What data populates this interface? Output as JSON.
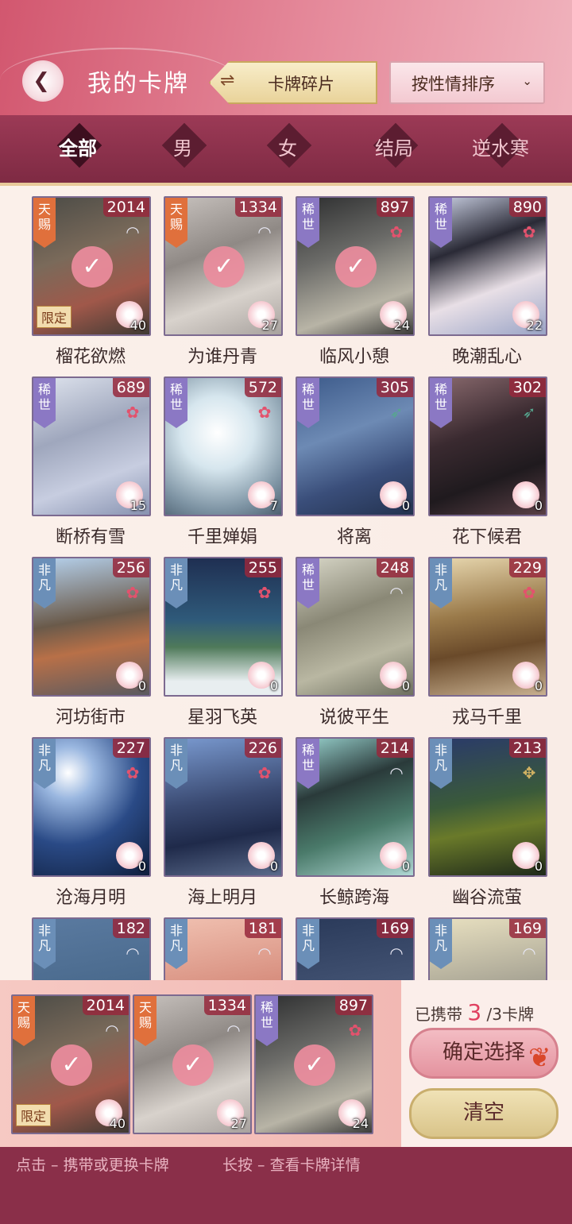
{
  "header": {
    "title": "我的卡牌",
    "fragments_label": "卡牌碎片",
    "sort_label": "按性情排序",
    "swap_icon": "⇌",
    "chevron": "⌄",
    "back_icon": "❮"
  },
  "filters": [
    "全部",
    "男",
    "女",
    "结局",
    "逆水寒"
  ],
  "cards": [
    {
      "name": "榴花欲燃",
      "num": "2014",
      "rarity": "天赐",
      "rclass": "tianci",
      "emb": "fan",
      "lvl": "40",
      "checked": true,
      "limited": "限定",
      "bg": "linear-gradient(160deg,#4b4b46,#7a6a5a 40%,#a0584a 70%,#3f3a34)"
    },
    {
      "name": "为谁丹青",
      "num": "1334",
      "rarity": "天赐",
      "rclass": "tianci",
      "emb": "fan",
      "lvl": "27",
      "checked": true,
      "bg": "linear-gradient(160deg,#c8c2be,#8f8985 40%,#d8d2cc 70%,#a8a29e)"
    },
    {
      "name": "临风小憩",
      "num": "897",
      "rarity": "稀世",
      "rclass": "xishi",
      "emb": "flower",
      "lvl": "24",
      "checked": true,
      "bg": "linear-gradient(160deg,#2d2e2f,#6b6b68 40%,#b8b4a6 75%,#3c3c3a)"
    },
    {
      "name": "晚潮乱心",
      "num": "890",
      "rarity": "稀世",
      "rclass": "xishi",
      "emb": "flower",
      "lvl": "22",
      "checked": false,
      "bg": "linear-gradient(160deg,#cdd3e6,#2a2a36 35%,#e8dfe6 65%,#9aa4c6)"
    },
    {
      "name": "断桥有雪",
      "num": "689",
      "rarity": "稀世",
      "rclass": "xishi",
      "emb": "flower",
      "lvl": "15",
      "checked": false,
      "bg": "linear-gradient(160deg,#dfe4ee,#9fa7bd 40%,#c7cde0 70%,#8792b0)"
    },
    {
      "name": "千里婵娟",
      "num": "572",
      "rarity": "稀世",
      "rclass": "xishi",
      "emb": "flower",
      "lvl": "7",
      "checked": false,
      "bg": "radial-gradient(circle at 45% 40%,#ffffff,#d6e6ee 35%,#7d93a3 75%,#4d6070)"
    },
    {
      "name": "将离",
      "num": "305",
      "rarity": "稀世",
      "rclass": "xishi",
      "emb": "bow",
      "lvl": "0",
      "checked": false,
      "bg": "linear-gradient(160deg,#3c5a8a,#6d8ab4 40%,#3a4e7a 70%,#23324f)"
    },
    {
      "name": "花下候君",
      "num": "302",
      "rarity": "稀世",
      "rclass": "xishi",
      "emb": "bow",
      "lvl": "0",
      "checked": false,
      "bg": "linear-gradient(160deg,#8a6a6e,#3a2a30 40%,#1f1a1e 70%,#5a4046)"
    },
    {
      "name": "河坊街市",
      "num": "256",
      "rarity": "非凡",
      "rclass": "feifan",
      "emb": "flower",
      "lvl": "0",
      "checked": false,
      "bg": "linear-gradient(170deg,#b6d2ee,#6a5a4a 45%,#b87048 65%,#5a5a60)"
    },
    {
      "name": "星羽飞英",
      "num": "255",
      "rarity": "非凡",
      "rclass": "feifan",
      "emb": "flower",
      "lvl": "0",
      "checked": false,
      "bg": "linear-gradient(180deg,#1f2f52,#2f5a7a 45%,#4f7a5a 65%,#e8eef0 90%)"
    },
    {
      "name": "说彼平生",
      "num": "248",
      "rarity": "稀世",
      "rclass": "xishi",
      "emb": "fan",
      "lvl": "0",
      "checked": false,
      "bg": "linear-gradient(160deg,#d9d8c9,#8a8876 40%,#b9b7a2 70%,#6e7060)"
    },
    {
      "name": "戎马千里",
      "num": "229",
      "rarity": "非凡",
      "rclass": "feifan",
      "emb": "flower",
      "lvl": "0",
      "checked": false,
      "bg": "linear-gradient(170deg,#e8d8b0,#9a7a4a 40%,#6a4a2a 65%,#c8b090)"
    },
    {
      "name": "沧海月明",
      "num": "227",
      "rarity": "非凡",
      "rclass": "feifan",
      "emb": "flower",
      "lvl": "0",
      "checked": false,
      "bg": "radial-gradient(circle at 30% 25%,#ffffff,#9ab7e0 20%,#2a4a86 55%,#0f1e3c)"
    },
    {
      "name": "海上明月",
      "num": "226",
      "rarity": "非凡",
      "rclass": "feifan",
      "emb": "flower",
      "lvl": "0",
      "checked": false,
      "bg": "linear-gradient(170deg,#7a9ad0,#3a4a72 45%,#1f2a4a 70%,#5a6a8a)"
    },
    {
      "name": "长鲸跨海",
      "num": "214",
      "rarity": "稀世",
      "rclass": "xishi",
      "emb": "fan",
      "lvl": "0",
      "checked": false,
      "bg": "linear-gradient(160deg,#9ad4d0,#2a3a3a 35%,#4a7a6a 65%,#b0d8d4)"
    },
    {
      "name": "幽谷流萤",
      "num": "213",
      "rarity": "非凡",
      "rclass": "feifan",
      "emb": "gold",
      "lvl": "0",
      "checked": false,
      "bg": "linear-gradient(170deg,#2a3a6a,#3a5a3a 45%,#6a7a2a 65%,#1f2a1a)"
    },
    {
      "name": "",
      "num": "182",
      "rarity": "非凡",
      "rclass": "feifan",
      "emb": "fan",
      "lvl": "",
      "checked": false,
      "bg": "linear-gradient(170deg,#5a7aa0,#3a5a7a)"
    },
    {
      "name": "",
      "num": "181",
      "rarity": "非凡",
      "rclass": "feifan",
      "emb": "fan",
      "lvl": "",
      "checked": false,
      "bg": "linear-gradient(170deg,#f0c0b0,#c06050)"
    },
    {
      "name": "",
      "num": "169",
      "rarity": "非凡",
      "rclass": "feifan",
      "emb": "fan",
      "lvl": "",
      "checked": false,
      "bg": "linear-gradient(170deg,#2a3a5a,#5a6a8a)"
    },
    {
      "name": "",
      "num": "169",
      "rarity": "非凡",
      "rclass": "feifan",
      "emb": "fan",
      "lvl": "",
      "checked": false,
      "bg": "linear-gradient(170deg,#e8e0c0,#6a6a6a)"
    }
  ],
  "carried": [
    {
      "num": "2014",
      "rarity": "天赐",
      "rclass": "tianci",
      "emb": "fan",
      "lvl": "40",
      "limited": "限定",
      "bg": "linear-gradient(160deg,#4b4b46,#7a6a5a 40%,#a0584a 70%,#3f3a34)"
    },
    {
      "num": "1334",
      "rarity": "天赐",
      "rclass": "tianci",
      "emb": "fan",
      "lvl": "27",
      "bg": "linear-gradient(160deg,#c8c2be,#8f8985 40%,#d8d2cc 70%,#a8a29e)"
    },
    {
      "num": "897",
      "rarity": "稀世",
      "rclass": "xishi",
      "emb": "flower",
      "lvl": "24",
      "bg": "linear-gradient(160deg,#2d2e2f,#6b6b68 40%,#b8b4a6 75%,#3c3c3a)"
    }
  ],
  "carry": {
    "prefix": "已携带",
    "count": "3",
    "suffix": "/3卡牌"
  },
  "buttons": {
    "confirm": "确定选择",
    "clear": "清空"
  },
  "hints": {
    "tap": "点击 – 携带或更换卡牌",
    "hold": "长按 – 查看卡牌详情"
  },
  "icons": {
    "check": "✓",
    "flower": "✿",
    "fan": "◠",
    "bow": "➶",
    "gold": "✥",
    "leaf": "❦"
  }
}
